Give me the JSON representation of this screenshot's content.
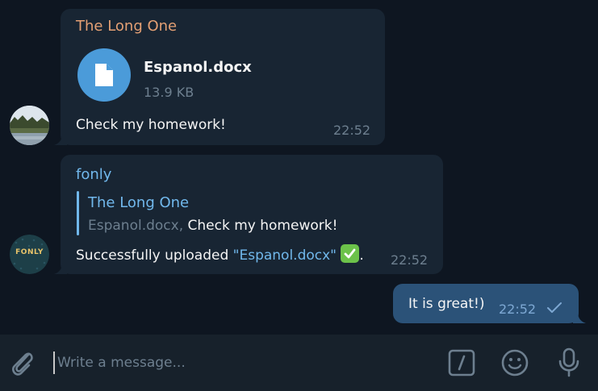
{
  "messages": [
    {
      "sender": "The Long One",
      "file": {
        "name": "Espanol.docx",
        "size": "13.9 KB",
        "icon": "document-icon"
      },
      "text": "Check my homework!",
      "time": "22:52"
    },
    {
      "sender": "fonly",
      "avatar_text": "FONLY",
      "reply": {
        "name": "The Long One",
        "file": "Espanol.docx,",
        "text": "Check my homework!"
      },
      "text_prefix": "Successfully uploaded ",
      "text_link": "\"Espanol.docx\"",
      "text_suffix": ".",
      "emoji": "check-mark-emoji",
      "time": "22:52"
    },
    {
      "outgoing": true,
      "text": "It is great!)",
      "time": "22:52",
      "status_icon": "single-check-icon"
    }
  ],
  "composer": {
    "placeholder": "Write a message...",
    "icons": [
      "attach-icon",
      "commands-icon",
      "emoji-icon",
      "microphone-icon"
    ]
  },
  "colors": {
    "background": "#0e1621",
    "incoming_bubble": "#182533",
    "outgoing_bubble": "#2b5278",
    "accent": "#71b8ec",
    "sender_orange": "#e4a074"
  }
}
